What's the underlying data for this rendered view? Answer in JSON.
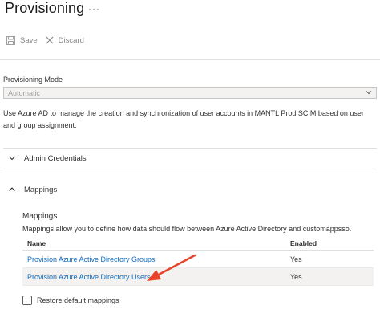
{
  "header": {
    "title": "Provisioning",
    "more_label": "···"
  },
  "toolbar": {
    "save_label": "Save",
    "discard_label": "Discard"
  },
  "form": {
    "mode_label": "Provisioning Mode",
    "mode_value": "Automatic",
    "description": "Use Azure AD to manage the creation and synchronization of user accounts in MANTL Prod SCIM based on user and group assignment."
  },
  "sections": {
    "admin_credentials": "Admin Credentials",
    "mappings": "Mappings"
  },
  "mappings": {
    "title": "Mappings",
    "description": "Mappings allow you to define how data should flow between Azure Active Directory and customappsso.",
    "columns": {
      "name": "Name",
      "enabled": "Enabled"
    },
    "rows": [
      {
        "name": "Provision Azure Active Directory Groups",
        "enabled": "Yes"
      },
      {
        "name": "Provision Azure Active Directory Users",
        "enabled": "Yes"
      }
    ],
    "restore_label": "Restore default mappings"
  },
  "colors": {
    "link": "#0f6cbd",
    "annotation_arrow": "#e8432a",
    "row_highlight": "#f3f2f1"
  }
}
